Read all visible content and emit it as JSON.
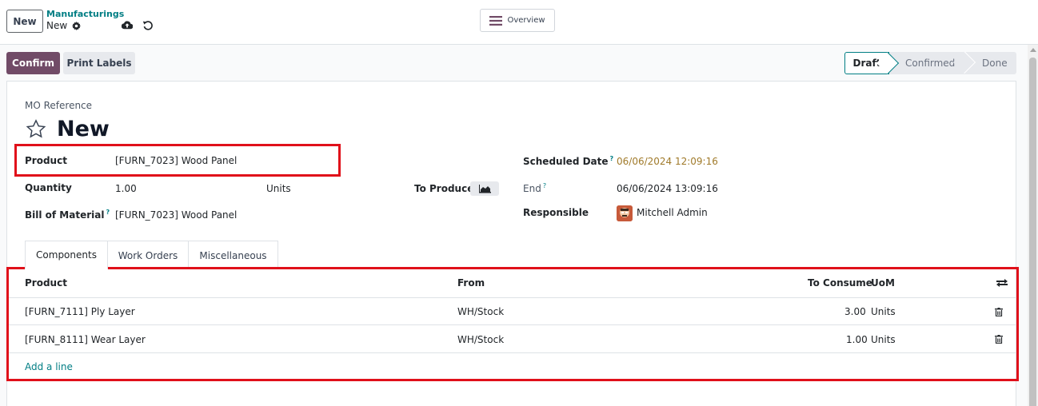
{
  "topbar": {
    "new_label": "New",
    "breadcrumb_parent": "Manufacturings",
    "breadcrumb_current": "New",
    "overview_label": "Overview"
  },
  "actions": {
    "confirm_label": "Confirm",
    "print_labels_label": "Print Labels"
  },
  "statusbar": {
    "stages": [
      "Draft",
      "Confirmed",
      "Done"
    ],
    "active": "Draft"
  },
  "form": {
    "ref_label": "MO Reference",
    "ref_value": "New",
    "product_label": "Product",
    "product_value": "[FURN_7023] Wood Panel",
    "quantity_label": "Quantity",
    "quantity_value": "1.00",
    "quantity_uom": "Units",
    "to_produce_label": "To Produce",
    "bom_label": "Bill of Material",
    "bom_value": "[FURN_7023] Wood Panel",
    "scheduled_label": "Scheduled Date",
    "scheduled_value": "06/06/2024 12:09:16",
    "end_label": "End",
    "end_value": "06/06/2024 13:09:16",
    "responsible_label": "Responsible",
    "responsible_value": "Mitchell Admin",
    "help_mark": "?"
  },
  "tabs": [
    "Components",
    "Work Orders",
    "Miscellaneous"
  ],
  "components": {
    "headers": {
      "product": "Product",
      "from": "From",
      "to_consume": "To Consume",
      "uom": "UoM"
    },
    "rows": [
      {
        "product": "[FURN_7111] Ply Layer",
        "from": "WH/Stock",
        "to_consume": "3.00",
        "uom": "Units"
      },
      {
        "product": "[FURN_8111] Wear Layer",
        "from": "WH/Stock",
        "to_consume": "1.00",
        "uom": "Units"
      }
    ],
    "add_line_label": "Add a line"
  },
  "colors": {
    "primary": "#714b67",
    "accent": "#017e84",
    "highlight": "#e0101a",
    "date_warning": "#a07a2a"
  }
}
